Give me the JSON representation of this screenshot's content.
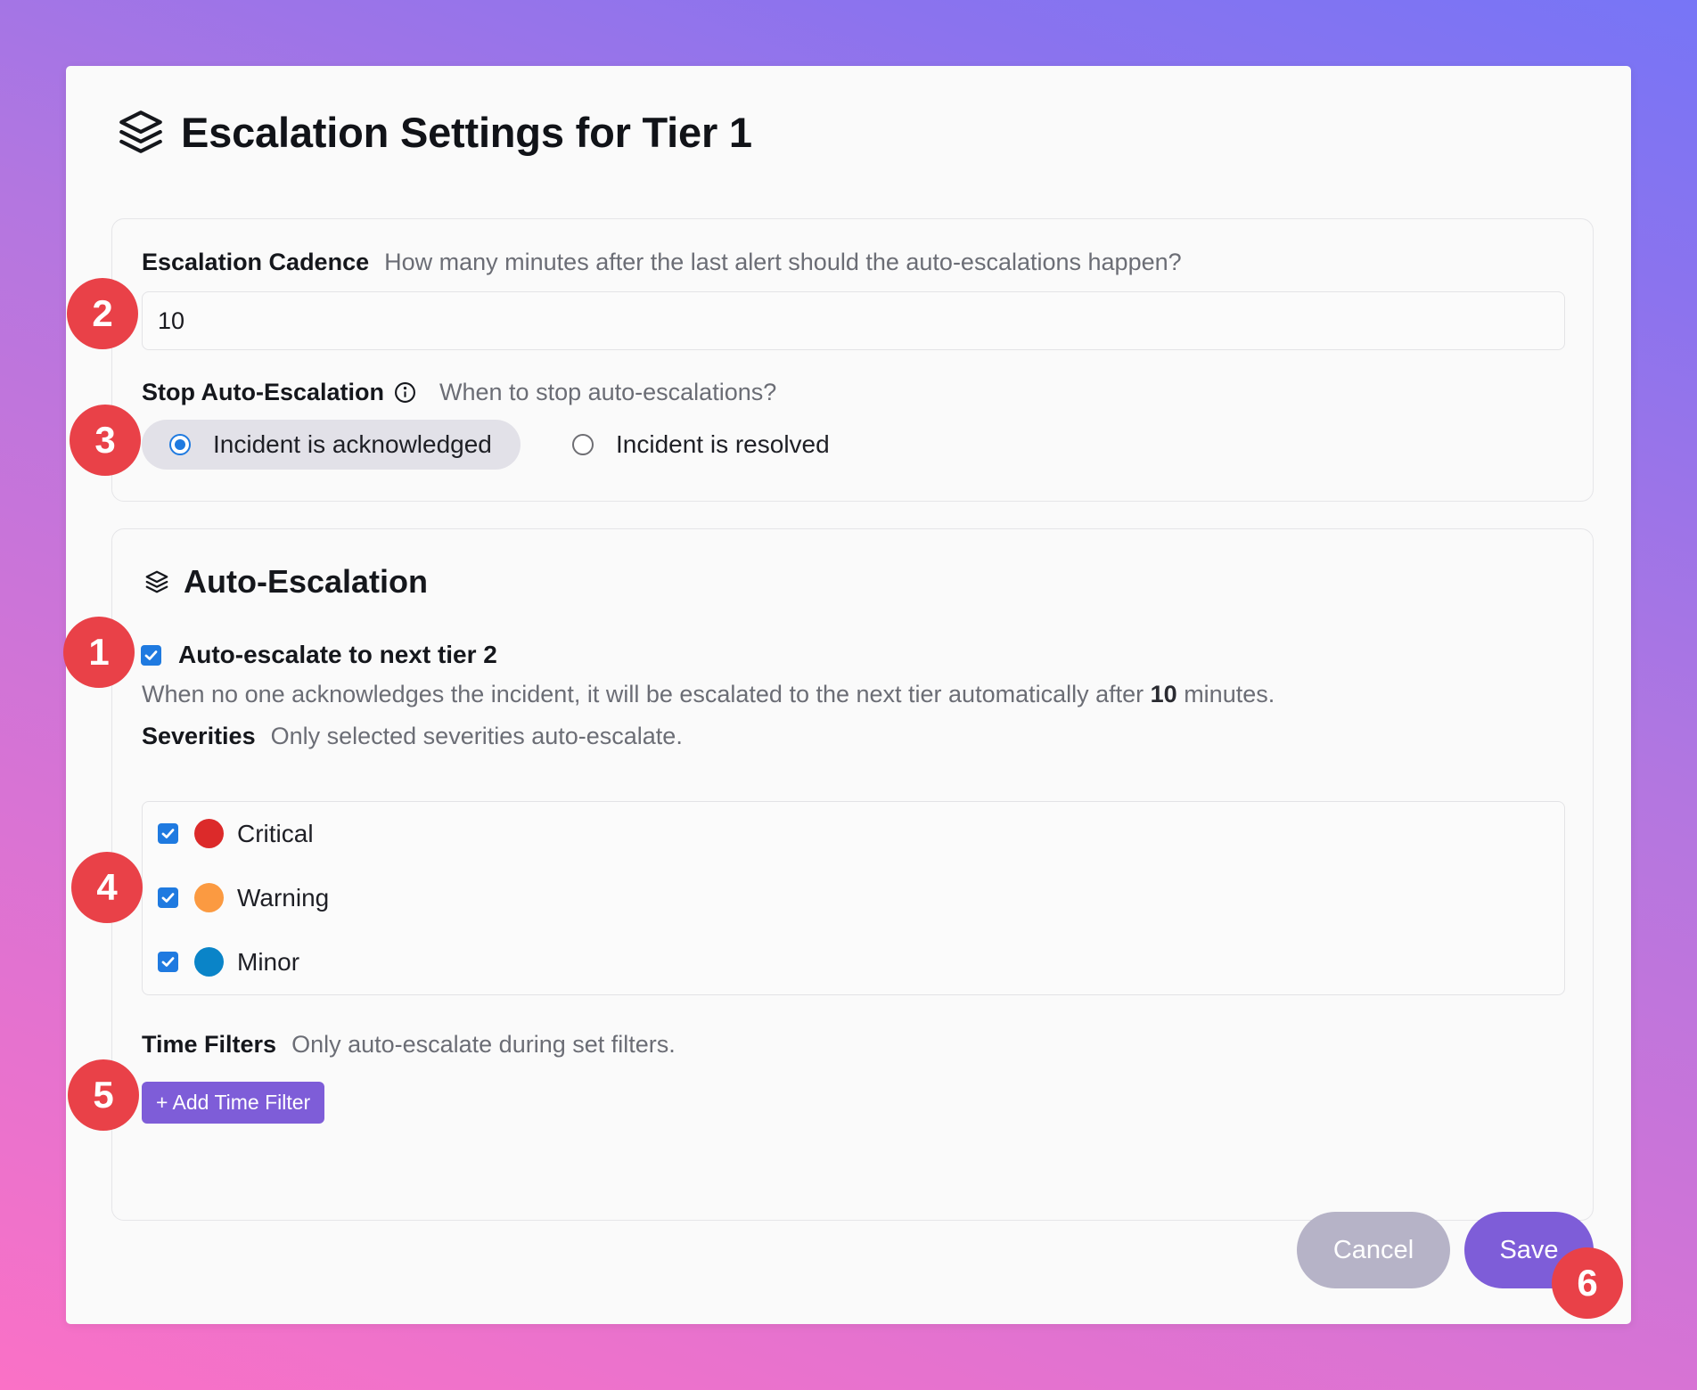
{
  "dialog": {
    "title": "Escalation Settings for Tier 1"
  },
  "cadence": {
    "label": "Escalation Cadence",
    "hint": "How many minutes after the last alert should the auto-escalations happen?",
    "value": "10"
  },
  "stop": {
    "label": "Stop Auto-Escalation",
    "hint": "When to stop auto-escalations?",
    "options": [
      {
        "label": "Incident is acknowledged",
        "selected": true
      },
      {
        "label": "Incident is resolved",
        "selected": false
      }
    ]
  },
  "auto_escalation": {
    "section_title": "Auto-Escalation",
    "checkbox_label": "Auto-escalate to next tier 2",
    "checked": true,
    "desc_prefix": "When no one acknowledges the incident, it will be escalated to the next tier automatically after ",
    "desc_value": "10",
    "desc_suffix": " minutes."
  },
  "severities": {
    "label": "Severities",
    "hint": "Only selected severities auto-escalate.",
    "items": [
      {
        "name": "Critical",
        "color": "#dc2a2a",
        "checked": true
      },
      {
        "name": "Warning",
        "color": "#fb9a41",
        "checked": true
      },
      {
        "name": "Minor",
        "color": "#0a84c8",
        "checked": true
      }
    ]
  },
  "time_filters": {
    "label": "Time Filters",
    "hint": "Only auto-escalate during set filters.",
    "add_button": "+ Add Time Filter"
  },
  "footer": {
    "cancel": "Cancel",
    "save": "Save"
  },
  "badges": [
    "1",
    "2",
    "3",
    "4",
    "5",
    "6"
  ],
  "colors": {
    "accent": "#7e5dd8",
    "check_blue": "#1f7ae0",
    "badge_red": "#e94148"
  }
}
